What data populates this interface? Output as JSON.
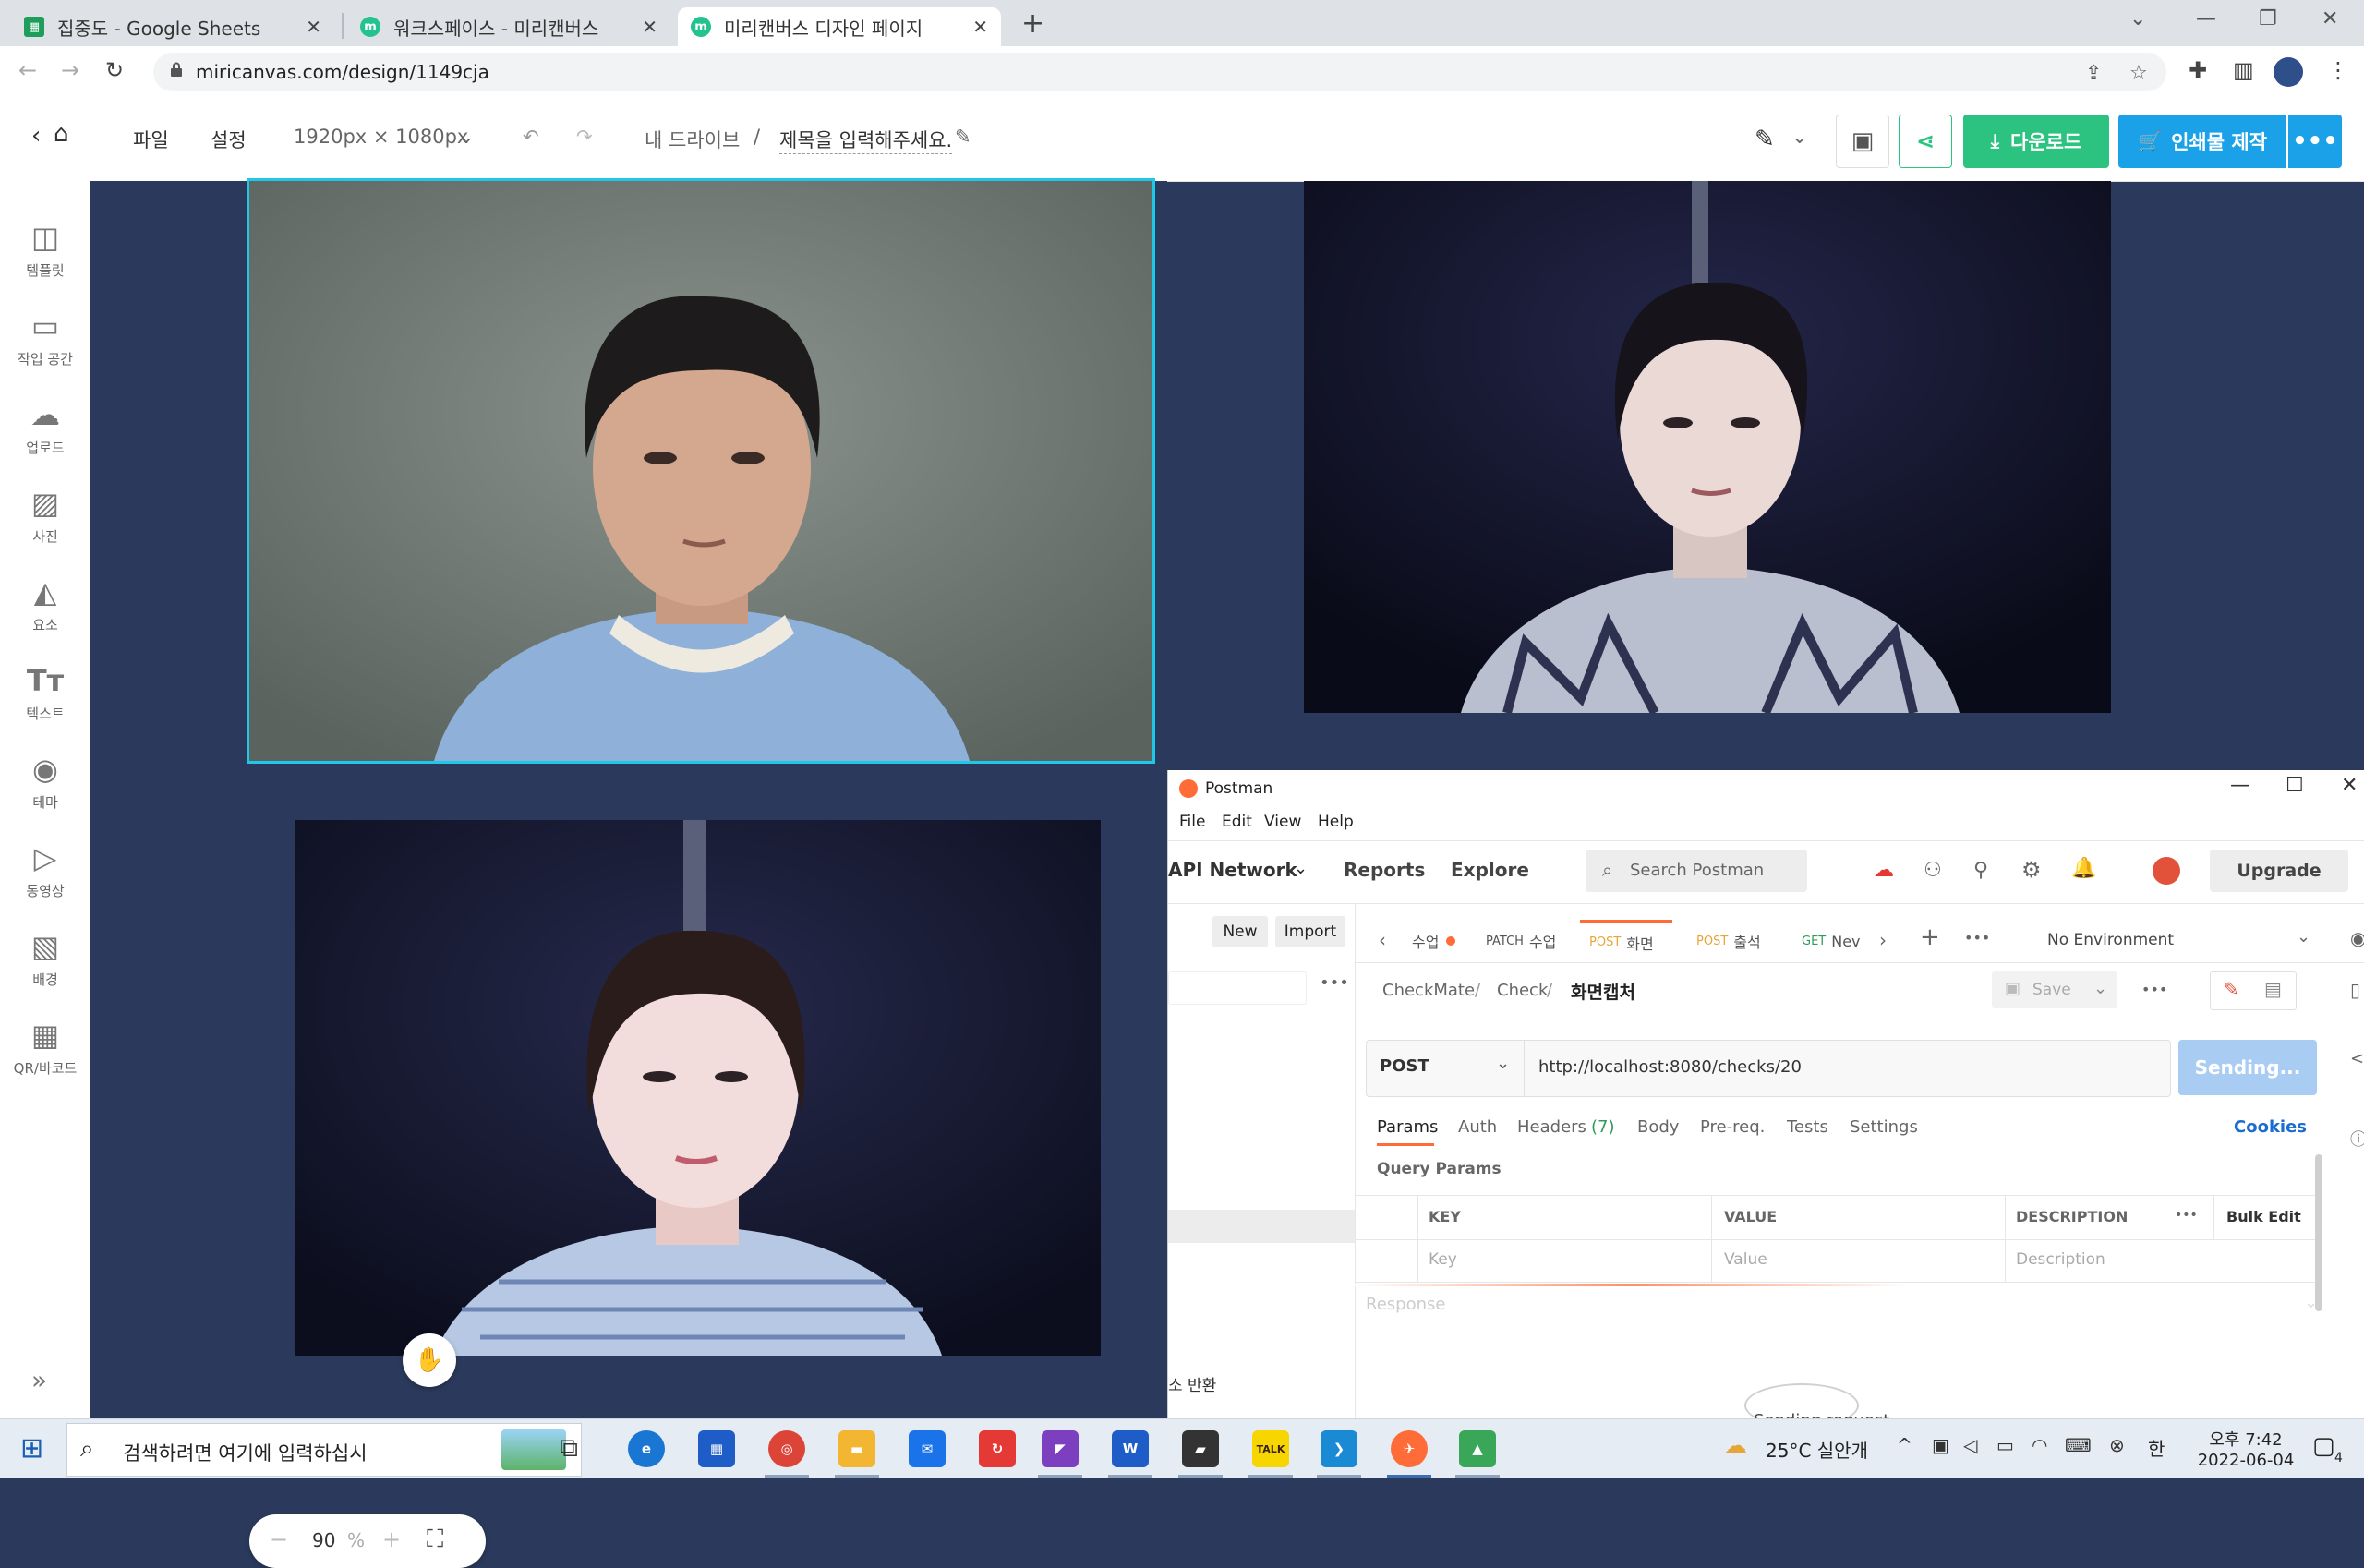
{
  "browser": {
    "tabs": [
      {
        "title": "집중도 - Google Sheets",
        "favicon": "sheets"
      },
      {
        "title": "워크스페이스 - 미리캔버스",
        "favicon": "miricanvas"
      },
      {
        "title": "미리캔버스 디자인 페이지",
        "favicon": "miricanvas",
        "active": true
      }
    ],
    "url": "miricanvas.com/design/1149cja"
  },
  "editor": {
    "menu_file": "파일",
    "menu_settings": "설정",
    "canvas_size": "1920px × 1080px",
    "breadcrumb_drive": "내 드라이브",
    "breadcrumb_sep": "/",
    "doc_title": "제목을 입력해주세요.",
    "download_label": "다운로드",
    "print_label": "인쇄물 제작",
    "download_color": "#2bc37f",
    "print_color": "#1aa1e8"
  },
  "sidebar": {
    "items": [
      {
        "label": "템플릿",
        "icon": "template-icon"
      },
      {
        "label": "작업 공간",
        "icon": "workspace-icon"
      },
      {
        "label": "업로드",
        "icon": "upload-icon"
      },
      {
        "label": "사진",
        "icon": "photo-icon"
      },
      {
        "label": "요소",
        "icon": "elements-icon"
      },
      {
        "label": "텍스트",
        "icon": "text-icon"
      },
      {
        "label": "테마",
        "icon": "palette-icon"
      },
      {
        "label": "동영상",
        "icon": "video-icon"
      },
      {
        "label": "배경",
        "icon": "background-icon"
      },
      {
        "label": "QR/바코드",
        "icon": "qr-icon"
      }
    ]
  },
  "canvas": {
    "zoom_value": "90",
    "zoom_unit": "%",
    "background_color": "#2b3a5c"
  },
  "postman": {
    "window_title": "Postman",
    "menu": [
      "File",
      "Edit",
      "View",
      "Help"
    ],
    "nav": {
      "api_network": "API Network",
      "reports": "Reports",
      "explore": "Explore"
    },
    "search_placeholder": "Search Postman",
    "upgrade_label": "Upgrade",
    "new_label": "New",
    "import_label": "Import",
    "request_tabs": [
      {
        "method": "",
        "name": "수업",
        "dot": true
      },
      {
        "method": "PATCH",
        "name": "수업"
      },
      {
        "method": "POST",
        "name": "화면",
        "active": true
      },
      {
        "method": "POST",
        "name": "출석"
      },
      {
        "method": "GET",
        "name": "Nev"
      }
    ],
    "environment": "No Environment",
    "breadcrumb": {
      "collection": "CheckMate",
      "folder": "Check",
      "request": "화면캡처",
      "sep": "/"
    },
    "save_label": "Save",
    "method": "POST",
    "request_url": "http://localhost:8080/checks/20",
    "send_label": "Sending...",
    "subtabs": {
      "params": "Params",
      "auth": "Auth",
      "headers": "Headers",
      "headers_count": "(7)",
      "body": "Body",
      "prereq": "Pre-req.",
      "tests": "Tests",
      "settings": "Settings"
    },
    "cookies_label": "Cookies",
    "query_params_label": "Query Params",
    "table_headers": {
      "key": "KEY",
      "value": "VALUE",
      "description": "DESCRIPTION",
      "bulk": "Bulk Edit"
    },
    "table_placeholders": {
      "key": "Key",
      "value": "Value",
      "description": "Description"
    },
    "response_label": "Response",
    "sidebar_fragment": "소 반환",
    "sending_text": "Sending request"
  },
  "taskbar": {
    "search_placeholder": "검색하려면 여기에 입력하십시",
    "weather": "25°C 실안개",
    "ime": "한",
    "time": "오후 7:42",
    "date": "2022-06-04",
    "notification_count": "4"
  }
}
